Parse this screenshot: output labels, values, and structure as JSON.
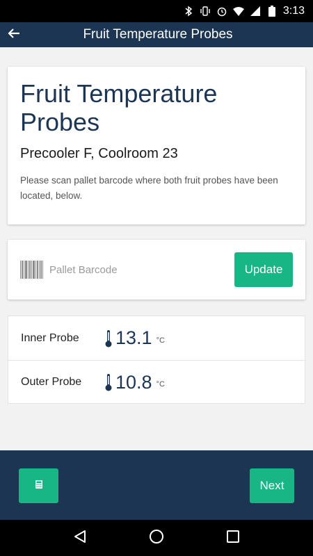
{
  "status_bar": {
    "time": "3:13",
    "icons": [
      "bluetooth-icon",
      "vibrate-icon",
      "alarm-icon",
      "wifi-icon",
      "signal-icon",
      "battery-icon"
    ]
  },
  "app_bar": {
    "title": "Fruit Temperature Probes",
    "back_icon": "arrow-left-icon"
  },
  "intro": {
    "title": "Fruit Temperature Probes",
    "subtitle": "Precooler F, Coolroom 23",
    "text": "Please scan pallet barcode where both fruit probes have been located, below."
  },
  "barcode": {
    "icon": "barcode-icon",
    "placeholder": "Pallet Barcode",
    "value": "",
    "update_label": "Update"
  },
  "probes": [
    {
      "label": "Inner Probe",
      "value": "13.1",
      "unit": "°C",
      "icon": "thermometer-icon"
    },
    {
      "label": "Outer Probe",
      "value": "10.8",
      "unit": "°C",
      "icon": "thermometer-icon"
    }
  ],
  "bottom": {
    "calculator_icon": "calculator-icon",
    "next_label": "Next"
  },
  "nav": {
    "icons": [
      "back-triangle-icon",
      "home-circle-icon",
      "recents-square-icon"
    ]
  },
  "colors": {
    "primary": "#1c3553",
    "accent": "#17b684"
  }
}
